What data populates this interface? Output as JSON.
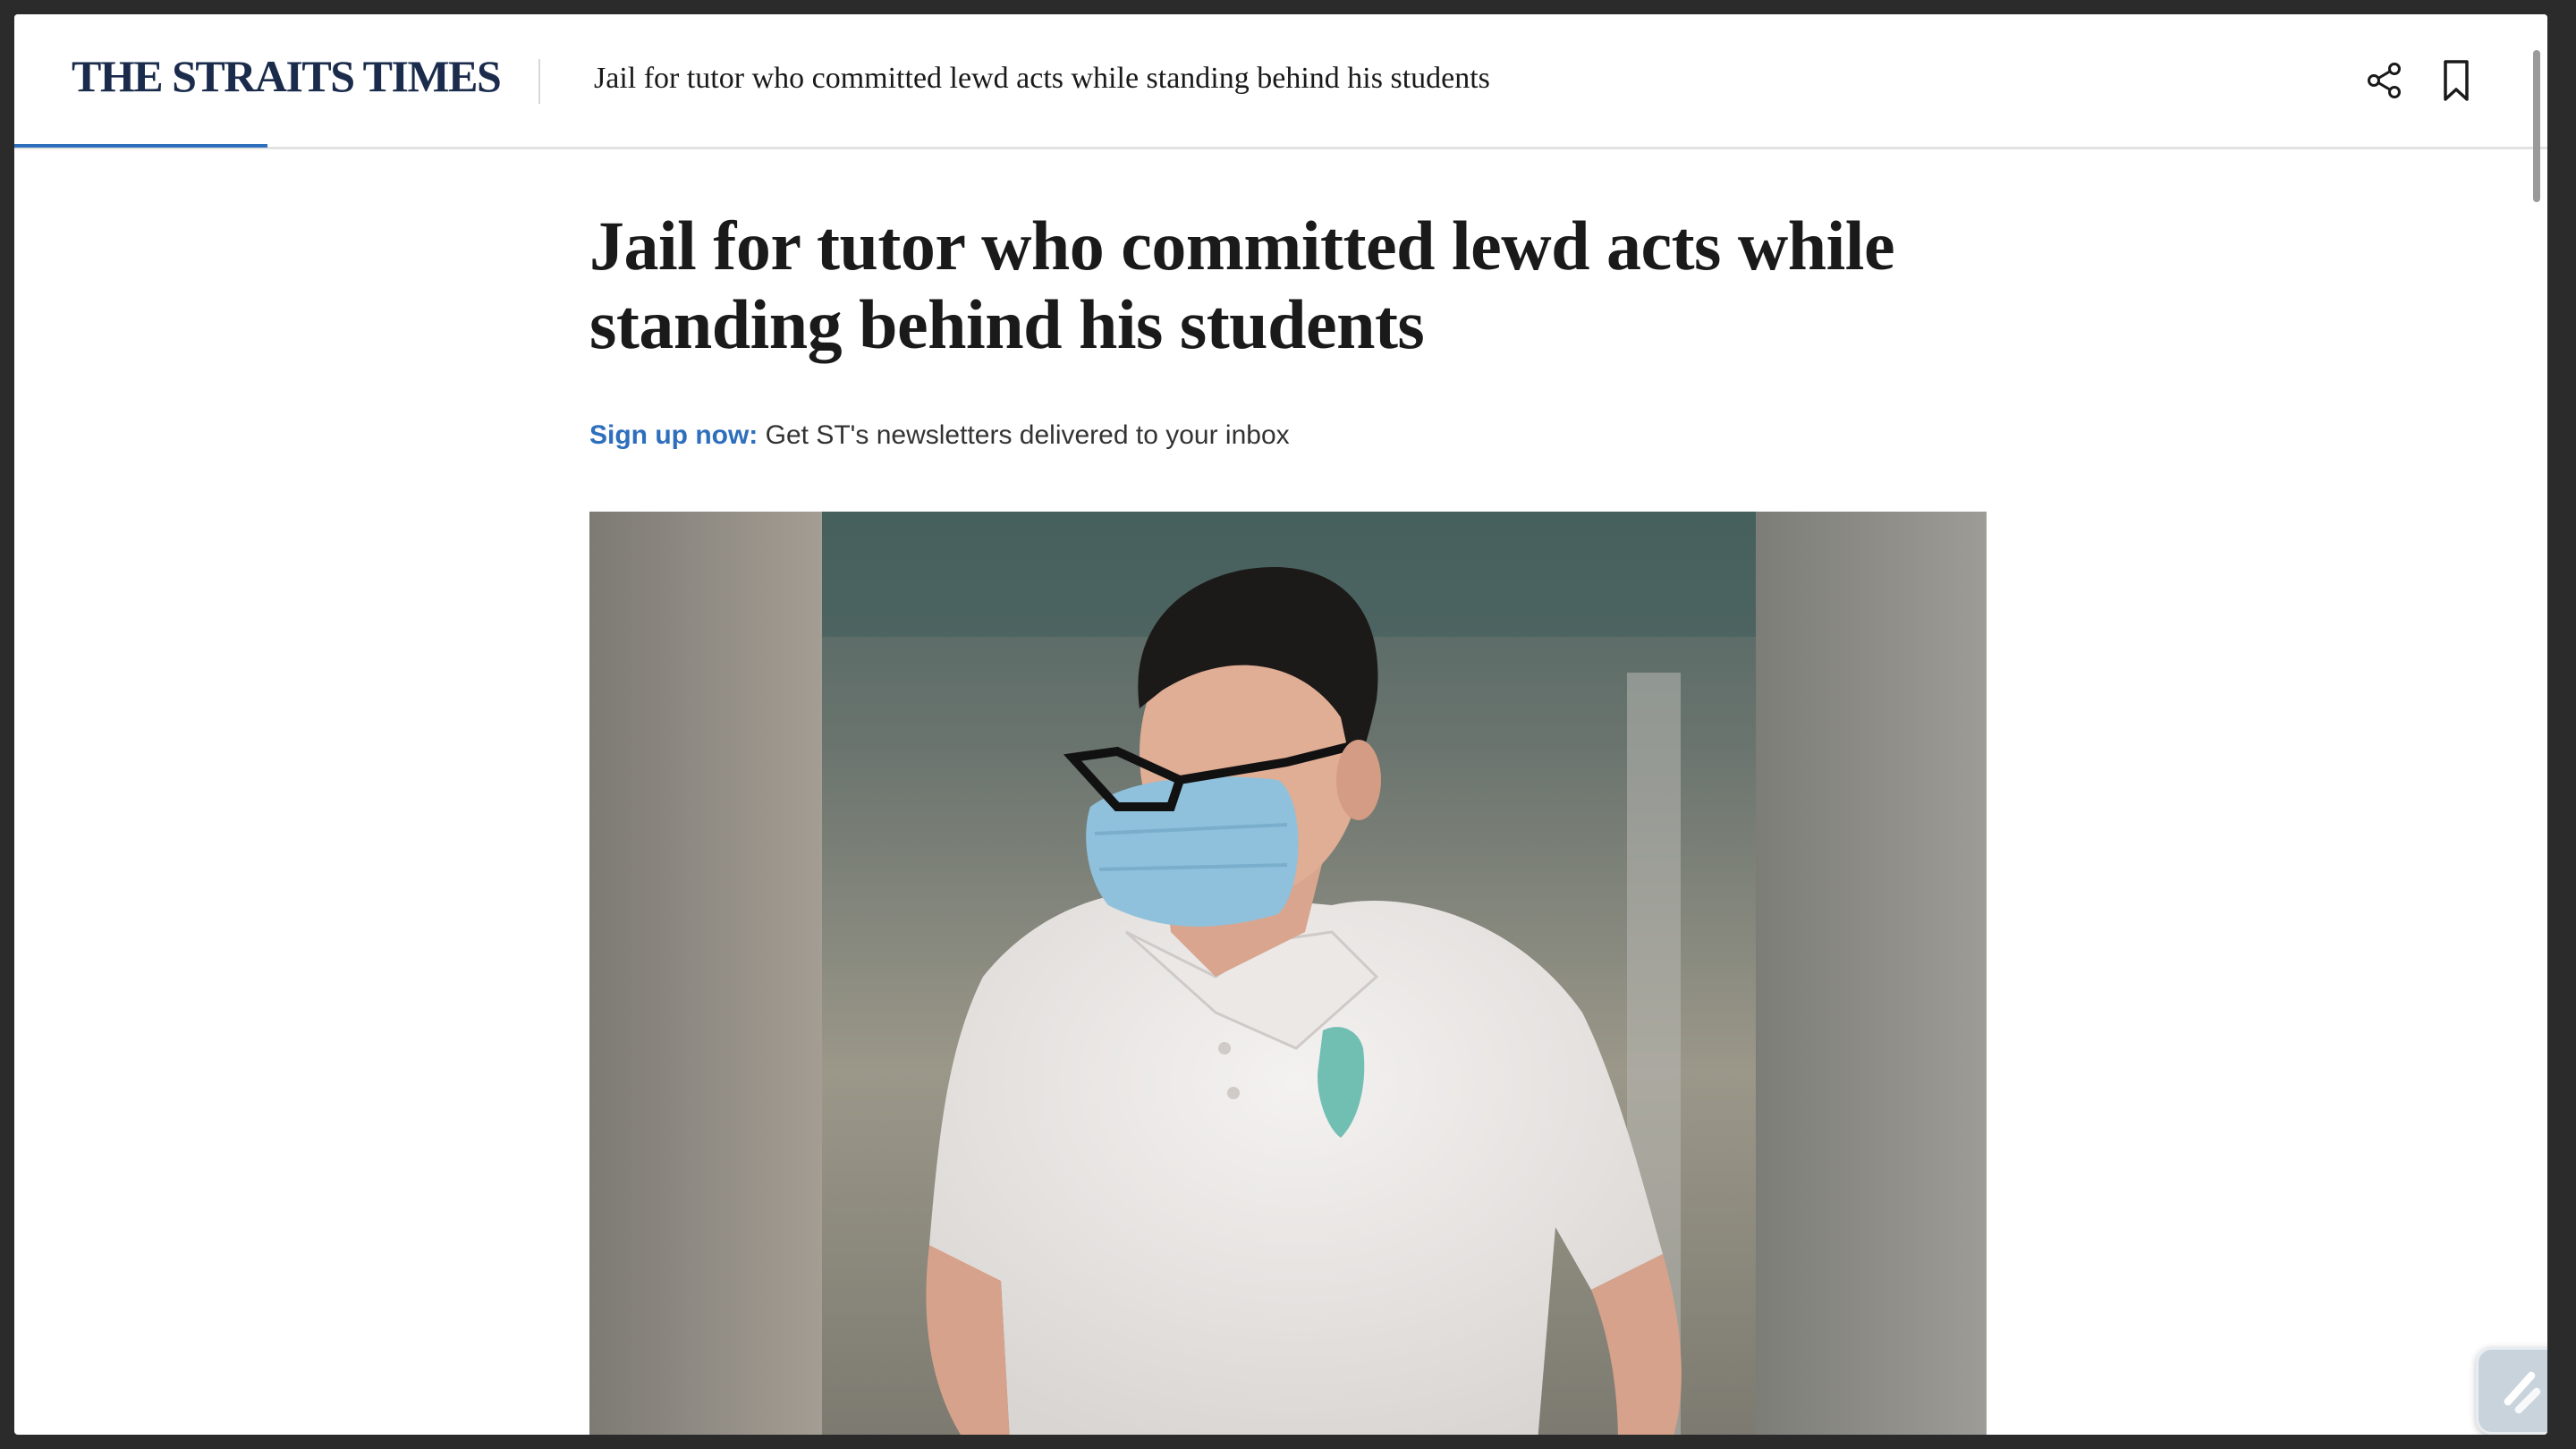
{
  "header": {
    "logo_text": "THE STRAITS TIMES",
    "article_title_short": "Jail for tutor who committed lewd acts while standing behind his students",
    "share_icon": "share-icon",
    "bookmark_icon": "bookmark-icon",
    "reading_progress_percent": 10
  },
  "article": {
    "title": "Jail for tutor who committed lewd acts while standing behind his students",
    "newsletter_cta": "Sign up now:",
    "newsletter_text": " Get ST's newsletters delivered to your inbox",
    "hero_image_alt": "Man wearing glasses, a blue surgical mask and a white polo shirt"
  },
  "colors": {
    "brand_navy": "#1a2b4c",
    "accent_blue": "#2e6fbd"
  },
  "floating_button_icon": "slash-app-icon"
}
